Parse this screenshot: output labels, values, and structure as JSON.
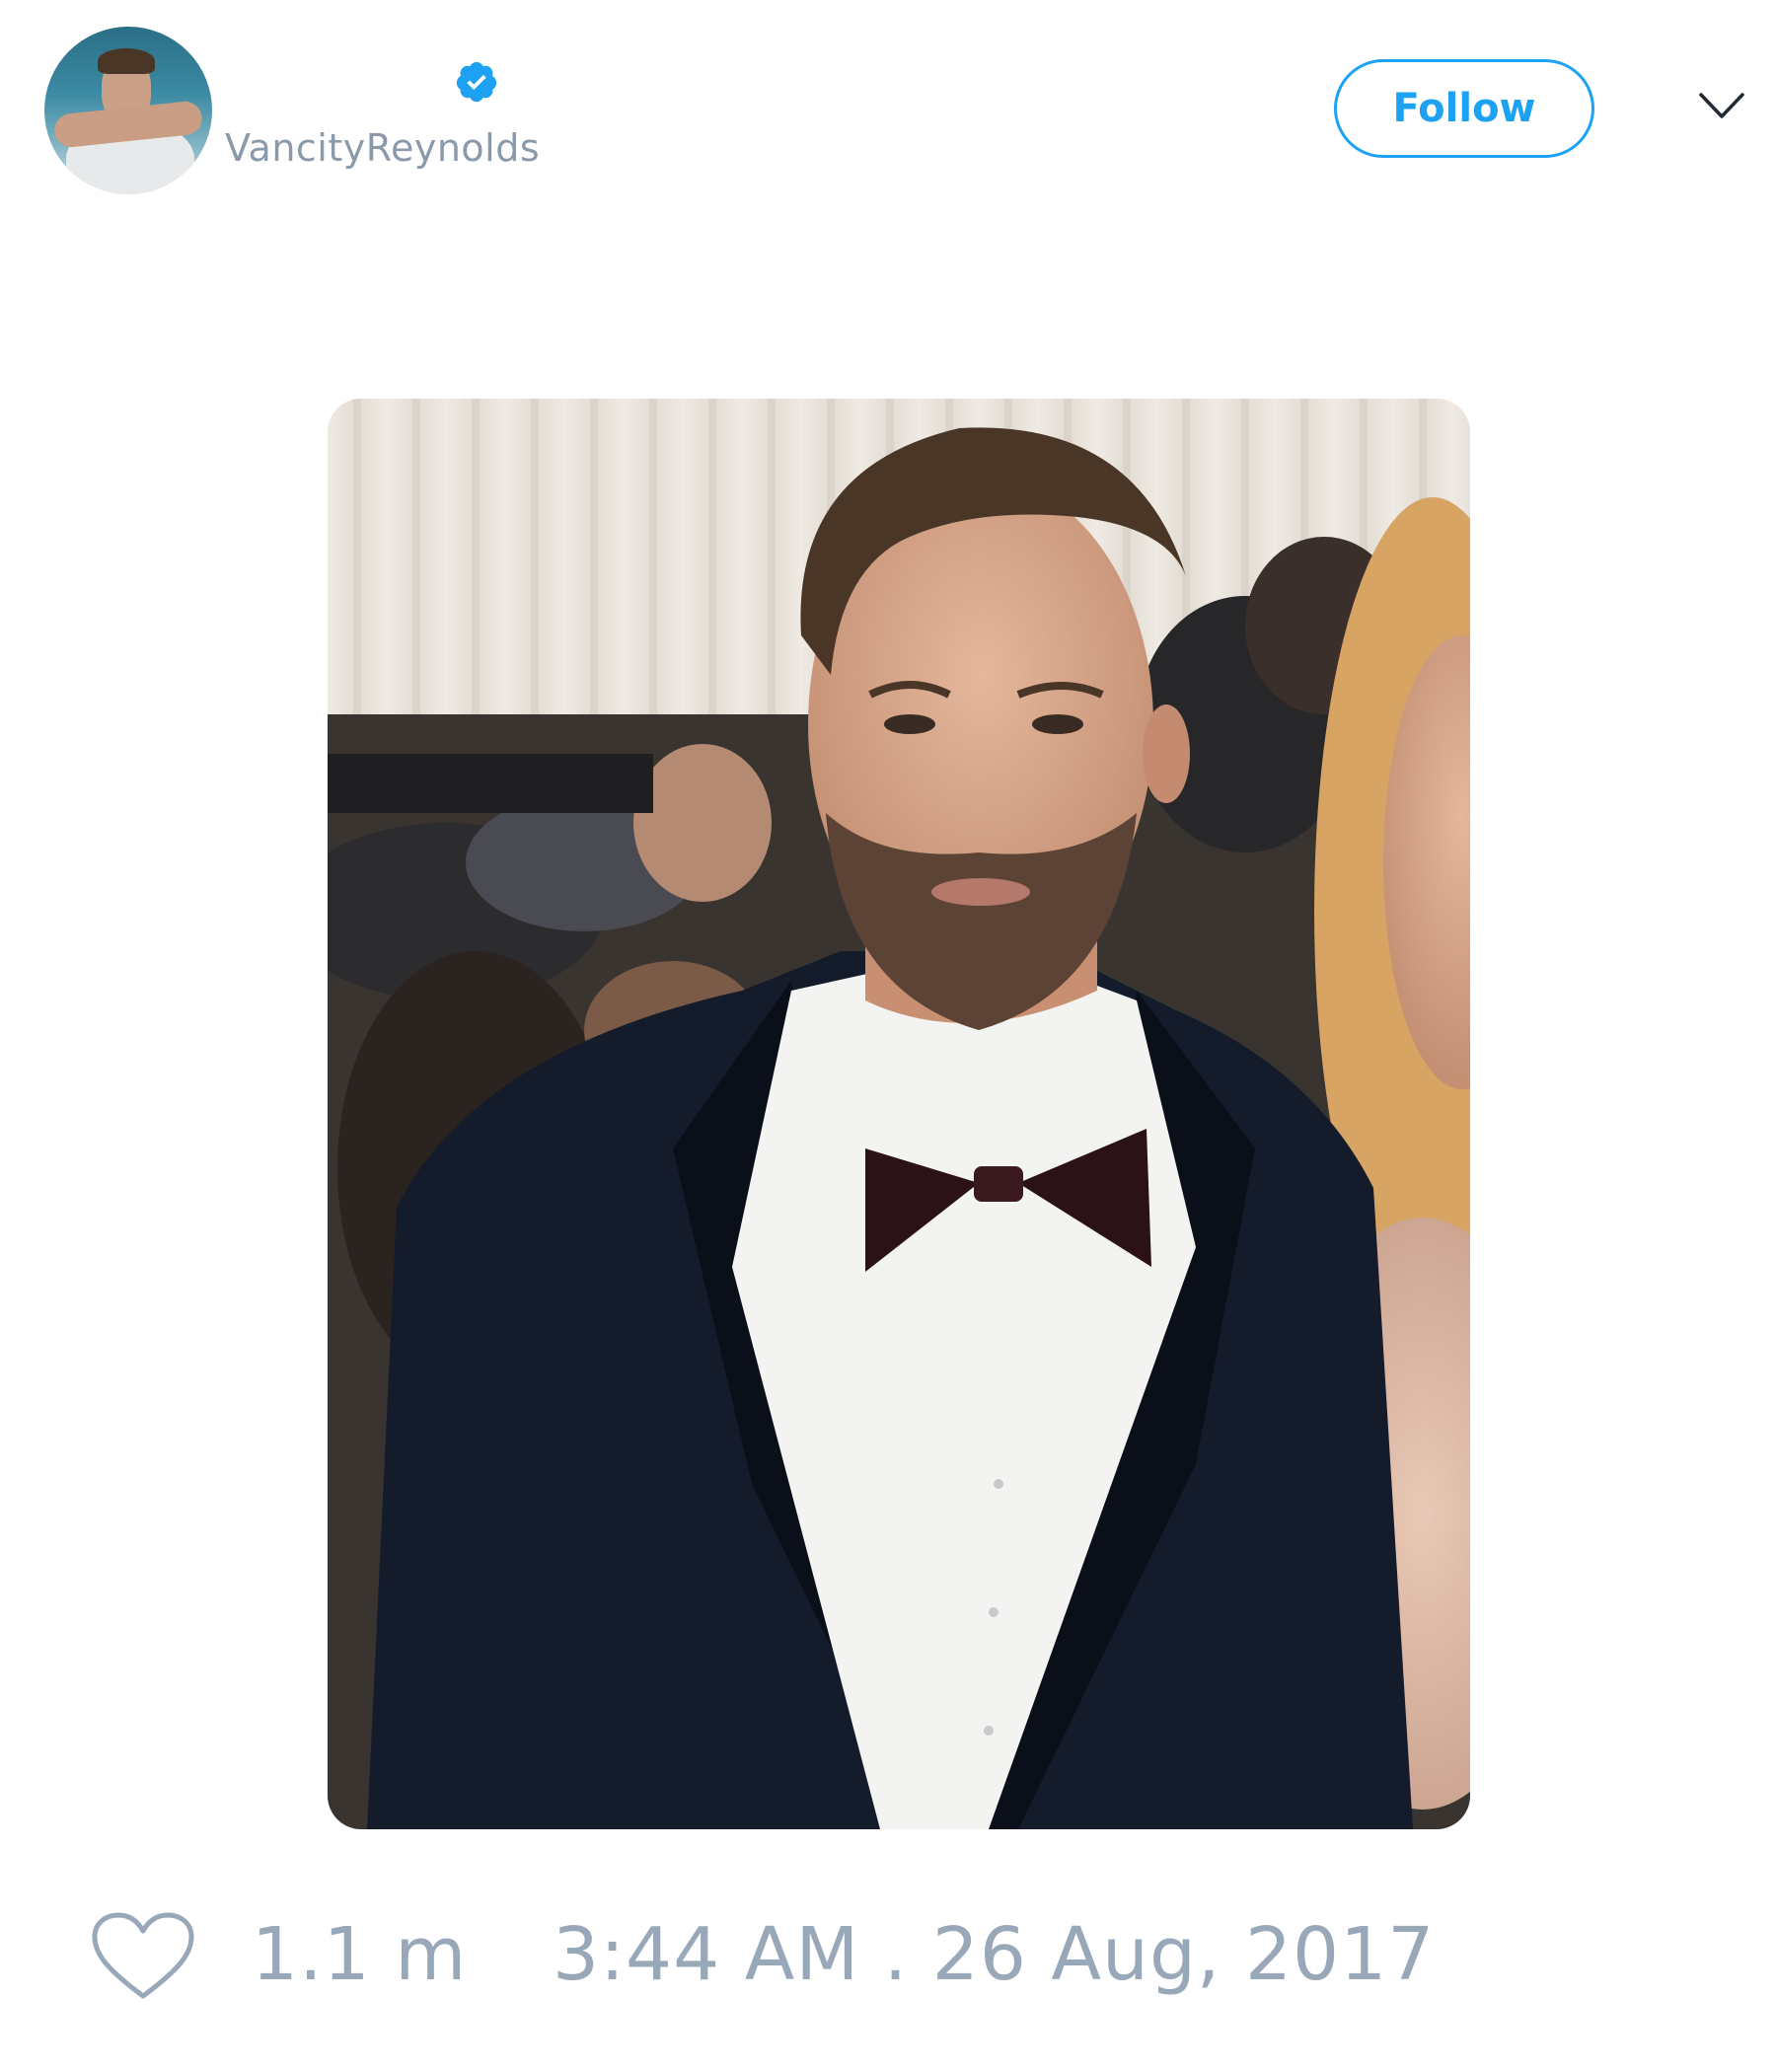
{
  "tweet": {
    "author": {
      "handle": "VancityReynolds",
      "verified": true,
      "avatar_description": "avatar"
    },
    "follow_button_label": "Follow",
    "menu_icon": "chevron-down-icon",
    "media": {
      "type": "photo"
    },
    "footer": {
      "like_icon": "heart-outline-icon",
      "likes_count": "1.1 m",
      "timestamp": "3:44 AM . 26 Aug, 2017"
    }
  },
  "colors": {
    "accent": "#1da1f2",
    "muted_text": "#98a8b8",
    "handle_text": "#8a9aab",
    "background": "#ffffff"
  }
}
